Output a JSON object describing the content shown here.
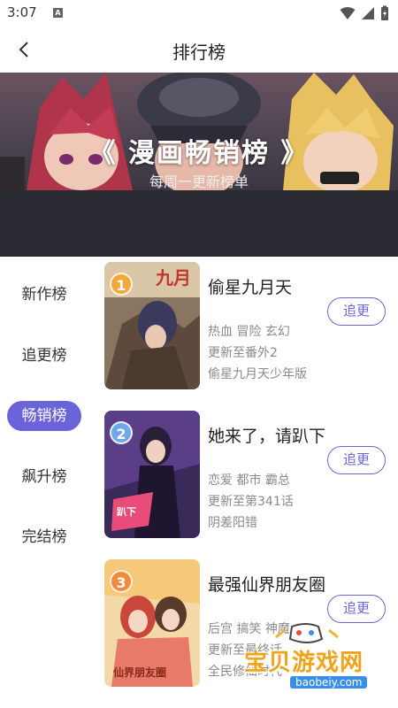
{
  "status": {
    "time": "3:07",
    "a_icon": "A"
  },
  "header": {
    "title": "排行榜"
  },
  "banner": {
    "title": "《 漫画畅销榜 》",
    "subtitle": "每周一更新榜单"
  },
  "sidebar": {
    "items": [
      {
        "label": "新作榜",
        "active": false
      },
      {
        "label": "追更榜",
        "active": false
      },
      {
        "label": "畅销榜",
        "active": true
      },
      {
        "label": "飙升榜",
        "active": false
      },
      {
        "label": "完结榜",
        "active": false
      }
    ]
  },
  "comics": [
    {
      "rank": "1",
      "title": "偷星九月天",
      "tags": "热血 冒险 玄幻",
      "update": "更新至番外2",
      "extra": "偷星九月天少年版",
      "follow": "追更"
    },
    {
      "rank": "2",
      "title": "她来了，请趴下",
      "tags": "恋爱 都市 霸总",
      "update": "更新至第341话",
      "extra": "阴差阳错",
      "follow": "追更"
    },
    {
      "rank": "3",
      "title": "最强仙界朋友圈",
      "tags": "后宫 搞笑 神魔",
      "update": "更新至最终话",
      "extra": "全民修仙时代",
      "follow": "追更"
    }
  ],
  "watermark": {
    "main": "宝贝游戏网",
    "url": "baobeiy.com"
  },
  "colors": {
    "accent": "#6b63d9",
    "rank1": "#f2a93b",
    "rank2": "#6fa8e8",
    "rank3": "#f28a3b"
  }
}
